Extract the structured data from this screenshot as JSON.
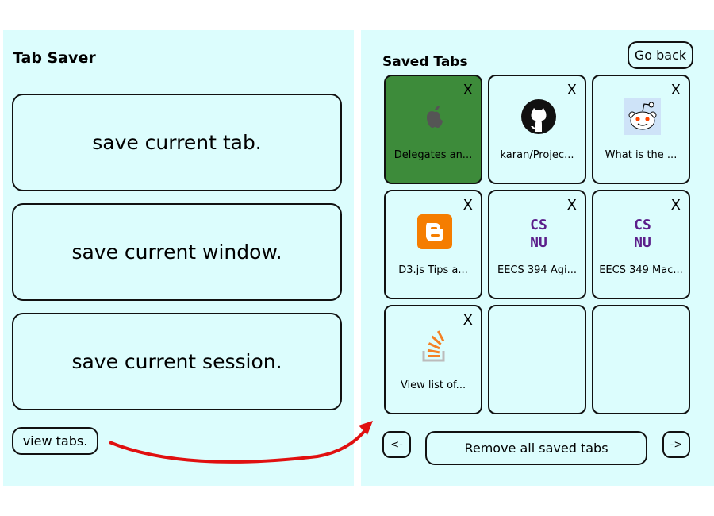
{
  "left": {
    "title": "Tab Saver",
    "buttons": {
      "save_tab": "save current tab.",
      "save_window": "save current window.",
      "save_session": "save current session."
    },
    "view_tabs": "view tabs."
  },
  "right": {
    "title": "Saved Tabs",
    "go_back": "Go back",
    "close_label": "X",
    "tiles": [
      {
        "label": "Delegates an...",
        "icon": "apple-icon",
        "selected": true
      },
      {
        "label": "karan/Projec...",
        "icon": "github-icon",
        "selected": false
      },
      {
        "label": "What is the ...",
        "icon": "reddit-icon",
        "selected": false
      },
      {
        "label": "D3.js Tips a...",
        "icon": "blogger-icon",
        "selected": false
      },
      {
        "label": "EECS 394 Agi...",
        "icon": "csnu-icon",
        "selected": false
      },
      {
        "label": "EECS 349 Mac...",
        "icon": "csnu-icon",
        "selected": false
      },
      {
        "label": "View list of...",
        "icon": "stackoverflow-icon",
        "selected": false
      }
    ],
    "csnu_text": [
      "CS",
      "NU"
    ],
    "prev": "<-",
    "remove_all": "Remove all saved tabs",
    "next": "->"
  },
  "colors": {
    "panel_bg": "#dcfdfd",
    "selected_tile": "#3d8b3a",
    "arrow": "#e01010"
  }
}
